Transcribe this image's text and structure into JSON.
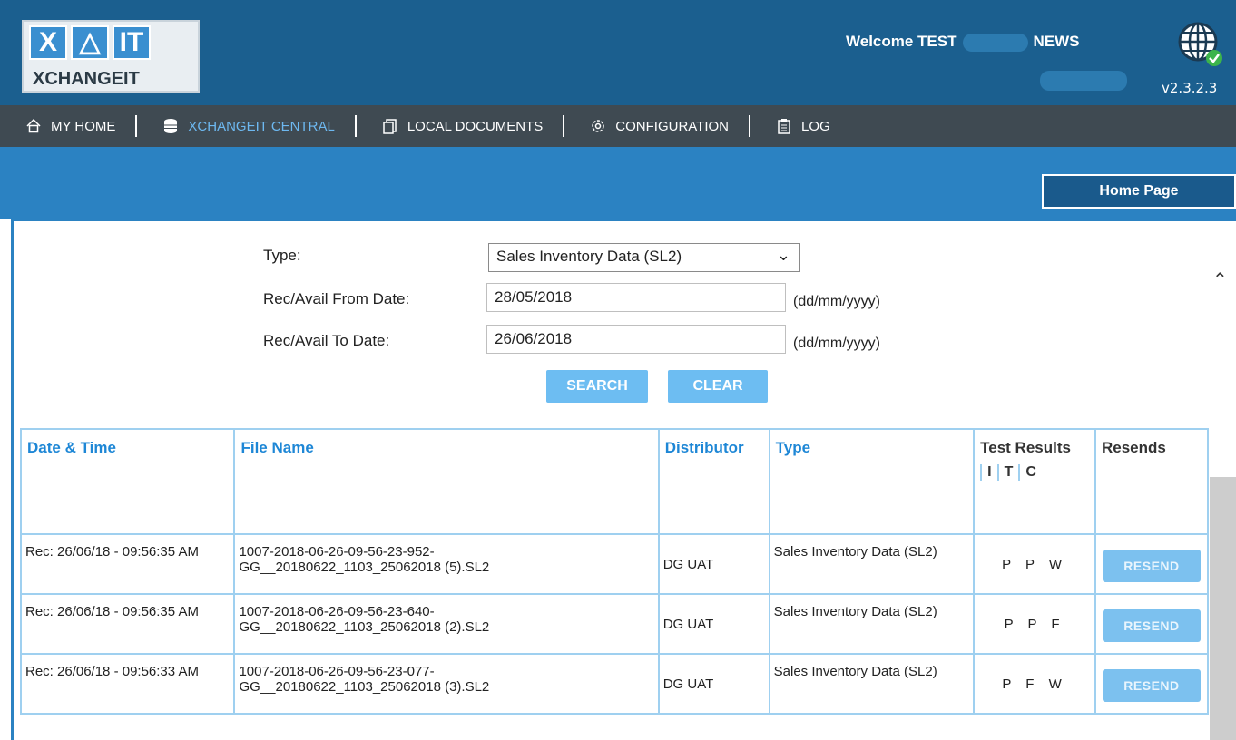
{
  "header": {
    "logo_letters": [
      "X",
      "△",
      "IT"
    ],
    "logo_word": "XCHANGEIT",
    "welcome_prefix": "Welcome TEST",
    "welcome_suffix": "NEWS",
    "version": "v2.3.2.3"
  },
  "nav": {
    "items": [
      {
        "label": "MY HOME",
        "icon": "home-icon"
      },
      {
        "label": "XCHANGEIT CENTRAL",
        "icon": "database-icon"
      },
      {
        "label": "LOCAL DOCUMENTS",
        "icon": "documents-icon"
      },
      {
        "label": "CONFIGURATION",
        "icon": "gear-icon"
      },
      {
        "label": "LOG",
        "icon": "clipboard-icon"
      }
    ]
  },
  "home_button": "Home Page",
  "form": {
    "type_label": "Type:",
    "type_value": "Sales Inventory Data (SL2)",
    "from_label": "Rec/Avail From Date:",
    "from_value": "28/05/2018",
    "to_label": "Rec/Avail To Date:",
    "to_value": "26/06/2018",
    "date_hint": "(dd/mm/yyyy)",
    "search_label": "SEARCH",
    "clear_label": "CLEAR"
  },
  "table": {
    "headers": {
      "datetime": "Date & Time",
      "filename": "File Name",
      "distributor": "Distributor",
      "type": "Type",
      "test_results": "Test Results",
      "itc": [
        "I",
        "T",
        "C"
      ],
      "resends": "Resends"
    },
    "rows": [
      {
        "datetime": "Rec: 26/06/18 - 09:56:35 AM",
        "file_a": "1007-2018-06-26-09-56-23-952-",
        "file_b": "GG__20180622_1103_25062018 (5).SL2",
        "distributor": "DG UAT",
        "type": "Sales Inventory Data (SL2)",
        "results": "P P W",
        "resend": "RESEND"
      },
      {
        "datetime": "Rec: 26/06/18 - 09:56:35 AM",
        "file_a": "1007-2018-06-26-09-56-23-640-",
        "file_b": "GG__20180622_1103_25062018 (2).SL2",
        "distributor": "DG UAT",
        "type": "Sales Inventory Data (SL2)",
        "results": "P P F",
        "resend": "RESEND"
      },
      {
        "datetime": "Rec: 26/06/18 - 09:56:33 AM",
        "file_a": "1007-2018-06-26-09-56-23-077-",
        "file_b": "GG__20180622_1103_25062018 (3).SL2",
        "distributor": "DG UAT",
        "type": "Sales Inventory Data (SL2)",
        "results": "P F W",
        "resend": "RESEND"
      }
    ]
  },
  "colors": {
    "header": "#1b5f8f",
    "nav": "#3f4a52",
    "band": "#2b82c2",
    "accent": "#1e87d6"
  }
}
